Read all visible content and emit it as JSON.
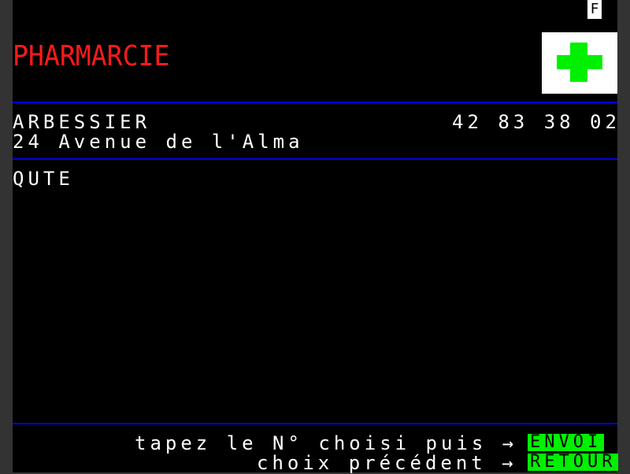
{
  "status": {
    "mode_indicator": "F"
  },
  "header": {
    "title": "PHARMARCIE",
    "logo_icon": "green-cross-icon"
  },
  "pharmacy": {
    "name": "ARBESSIER",
    "phone": "42 83 38 02",
    "address": "24 Avenue de l'Alma",
    "locality": "QUTE"
  },
  "footer": {
    "hint_send": "tapez le N° choisi puis →",
    "send_key": "ENVOI",
    "hint_back": "choix précédent →",
    "back_key": "RETOUR"
  },
  "colors": {
    "background": "#000000",
    "title": "#ff1a1a",
    "rule": "#0000ee",
    "key": "#00f000",
    "cross": "#00f000"
  }
}
